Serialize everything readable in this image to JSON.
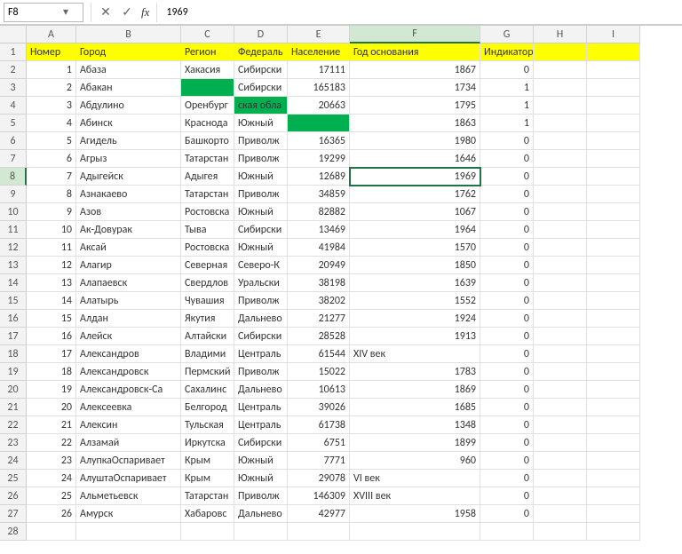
{
  "namebox": {
    "value": "F8"
  },
  "formula_bar": {
    "cancel": "✕",
    "accept": "✓",
    "fx": "fx",
    "value": "1969"
  },
  "columns": [
    "A",
    "B",
    "C",
    "D",
    "E",
    "F",
    "G",
    "H",
    "I"
  ],
  "active": {
    "col": "F",
    "row": 8
  },
  "headers": {
    "A": "Номер",
    "B": "Город",
    "C": "Регион",
    "D": "Федераль",
    "E": "Население",
    "F": "Год основания",
    "G": "Индикатор",
    "H": "",
    "I": ""
  },
  "rows": [
    {
      "n": 1,
      "A": "1",
      "B": "Абаза",
      "C": "Хакасия",
      "D": "Сибирски",
      "E": "17111",
      "F": "1867",
      "G": "0"
    },
    {
      "n": 2,
      "A": "2",
      "B": "Абакан",
      "C": "",
      "D": "Сибирски",
      "E": "165183",
      "F": "1734",
      "G": "1",
      "greenC": true
    },
    {
      "n": 3,
      "A": "3",
      "B": "Абдулино",
      "C": "Оренбург",
      "D": "ская обла",
      "E": "20663",
      "F": "1795",
      "G": "1",
      "greenD": true
    },
    {
      "n": 4,
      "A": "4",
      "B": "Абинск",
      "C": "Краснода",
      "D": "Южный",
      "E": "",
      "F": "1863",
      "G": "1",
      "greenE": true
    },
    {
      "n": 5,
      "A": "5",
      "B": "Агидель",
      "C": "Башкорто",
      "D": "Приволж",
      "E": "16365",
      "F": "1980",
      "G": "0"
    },
    {
      "n": 6,
      "A": "6",
      "B": "Агрыз",
      "C": "Татарстан",
      "D": "Приволж",
      "E": "19299",
      "F": "1646",
      "G": "0"
    },
    {
      "n": 7,
      "A": "7",
      "B": "Адыгейск",
      "C": "Адыгея",
      "D": "Южный",
      "E": "12689",
      "F": "1969",
      "G": "0",
      "active": true
    },
    {
      "n": 8,
      "A": "8",
      "B": "Азнакаево",
      "C": "Татарстан",
      "D": "Приволж",
      "E": "34859",
      "F": "1762",
      "G": "0"
    },
    {
      "n": 9,
      "A": "9",
      "B": "Азов",
      "C": "Ростовска",
      "D": "Южный",
      "E": "82882",
      "F": "1067",
      "G": "0"
    },
    {
      "n": 10,
      "A": "10",
      "B": "Ак-Довурак",
      "C": "Тыва",
      "D": "Сибирски",
      "E": "13469",
      "F": "1964",
      "G": "0"
    },
    {
      "n": 11,
      "A": "11",
      "B": "Аксай",
      "C": "Ростовска",
      "D": "Южный",
      "E": "41984",
      "F": "1570",
      "G": "0"
    },
    {
      "n": 12,
      "A": "12",
      "B": "Алагир",
      "C": "Северная",
      "D": "Северо-К",
      "E": "20949",
      "F": "1850",
      "G": "0"
    },
    {
      "n": 13,
      "A": "13",
      "B": "Алапаевск",
      "C": "Свердлов",
      "D": "Уральски",
      "E": "38198",
      "F": "1639",
      "G": "0"
    },
    {
      "n": 14,
      "A": "14",
      "B": "Алатырь",
      "C": "Чувашия",
      "D": "Приволж",
      "E": "38202",
      "F": "1552",
      "G": "0"
    },
    {
      "n": 15,
      "A": "15",
      "B": "Алдан",
      "C": "Якутия",
      "D": "Дальнево",
      "E": "21277",
      "F": "1924",
      "G": "0"
    },
    {
      "n": 16,
      "A": "16",
      "B": "Алейск",
      "C": "Алтайски",
      "D": "Сибирски",
      "E": "28528",
      "F": "1913",
      "G": "0"
    },
    {
      "n": 17,
      "A": "17",
      "B": "Александров",
      "C": "Владими",
      "D": "Централь",
      "E": "61544",
      "F": "XIV век",
      "G": "0",
      "Ftxt": true
    },
    {
      "n": 18,
      "A": "18",
      "B": "Александровск",
      "C": "Пермский",
      "D": "Приволж",
      "E": "15022",
      "F": "1783",
      "G": "0"
    },
    {
      "n": 19,
      "A": "19",
      "B": "Александровск-Са",
      "C": "Сахалинс",
      "D": "Дальнево",
      "E": "10613",
      "F": "1869",
      "G": "0"
    },
    {
      "n": 20,
      "A": "20",
      "B": "Алексеевка",
      "C": "Белгород",
      "D": "Централь",
      "E": "39026",
      "F": "1685",
      "G": "0"
    },
    {
      "n": 21,
      "A": "21",
      "B": "Алексин",
      "C": "Тульская",
      "D": "Централь",
      "E": "61738",
      "F": "1348",
      "G": "0"
    },
    {
      "n": 22,
      "A": "22",
      "B": "Алзамай",
      "C": "Иркутска",
      "D": "Сибирски",
      "E": "6751",
      "F": "1899",
      "G": "0"
    },
    {
      "n": 23,
      "A": "23",
      "B": "АлупкаОспаривает",
      "C": "Крым",
      "D": "Южный",
      "E": "7771",
      "F": "960",
      "G": "0"
    },
    {
      "n": 24,
      "A": "24",
      "B": "АлуштаОспаривает",
      "C": "Крым",
      "D": "Южный",
      "E": "29078",
      "F": "VI век",
      "G": "0",
      "Ftxt": true
    },
    {
      "n": 25,
      "A": "25",
      "B": "Альметьевск",
      "C": "Татарстан",
      "D": "Приволж",
      "E": "146309",
      "F": "XVIII век",
      "G": "0",
      "Ftxt": true
    },
    {
      "n": 26,
      "A": "26",
      "B": "Амурск",
      "C": "Хабаровс",
      "D": "Дальнево",
      "E": "42977",
      "F": "1958",
      "G": "0"
    },
    {
      "n": 27,
      "A": "",
      "B": "",
      "C": "",
      "D": "",
      "E": "",
      "F": "",
      "G": ""
    }
  ],
  "chart_data": {
    "type": "table",
    "title": "",
    "columns": [
      "Номер",
      "Город",
      "Регион",
      "Федераль",
      "Население",
      "Год основания",
      "Индикатор"
    ],
    "records": [
      [
        1,
        "Абаза",
        "Хакасия",
        "Сибирски",
        17111,
        1867,
        0
      ],
      [
        2,
        "Абакан",
        "",
        "Сибирски",
        165183,
        1734,
        1
      ],
      [
        3,
        "Абдулино",
        "Оренбург",
        "ская обла",
        20663,
        1795,
        1
      ],
      [
        4,
        "Абинск",
        "Краснода",
        "Южный",
        null,
        1863,
        1
      ],
      [
        5,
        "Агидель",
        "Башкорто",
        "Приволж",
        16365,
        1980,
        0
      ],
      [
        6,
        "Агрыз",
        "Татарстан",
        "Приволж",
        19299,
        1646,
        0
      ],
      [
        7,
        "Адыгейск",
        "Адыгея",
        "Южный",
        12689,
        1969,
        0
      ],
      [
        8,
        "Азнакаево",
        "Татарстан",
        "Приволж",
        34859,
        1762,
        0
      ],
      [
        9,
        "Азов",
        "Ростовска",
        "Южный",
        82882,
        1067,
        0
      ],
      [
        10,
        "Ак-Довурак",
        "Тыва",
        "Сибирски",
        13469,
        1964,
        0
      ],
      [
        11,
        "Аксай",
        "Ростовска",
        "Южный",
        41984,
        1570,
        0
      ],
      [
        12,
        "Алагир",
        "Северная",
        "Северо-К",
        20949,
        1850,
        0
      ],
      [
        13,
        "Алапаевск",
        "Свердлов",
        "Уральски",
        38198,
        1639,
        0
      ],
      [
        14,
        "Алатырь",
        "Чувашия",
        "Приволж",
        38202,
        1552,
        0
      ],
      [
        15,
        "Алдан",
        "Якутия",
        "Дальнево",
        21277,
        1924,
        0
      ],
      [
        16,
        "Алейск",
        "Алтайски",
        "Сибирски",
        28528,
        1913,
        0
      ],
      [
        17,
        "Александров",
        "Владими",
        "Централь",
        61544,
        "XIV век",
        0
      ],
      [
        18,
        "Александровск",
        "Пермский",
        "Приволж",
        15022,
        1783,
        0
      ],
      [
        19,
        "Александровск-Са",
        "Сахалинс",
        "Дальнево",
        10613,
        1869,
        0
      ],
      [
        20,
        "Алексеевка",
        "Белгород",
        "Централь",
        39026,
        1685,
        0
      ],
      [
        21,
        "Алексин",
        "Тульская",
        "Централь",
        61738,
        1348,
        0
      ],
      [
        22,
        "Алзамай",
        "Иркутска",
        "Сибирски",
        6751,
        1899,
        0
      ],
      [
        23,
        "АлупкаОспаривает",
        "Крым",
        "Южный",
        7771,
        960,
        0
      ],
      [
        24,
        "АлуштаОспаривает",
        "Крым",
        "Южный",
        29078,
        "VI век",
        0
      ],
      [
        25,
        "Альметьевск",
        "Татарстан",
        "Приволж",
        146309,
        "XVIII век",
        0
      ],
      [
        26,
        "Амурск",
        "Хабаровс",
        "Дальнево",
        42977,
        1958,
        0
      ]
    ]
  }
}
